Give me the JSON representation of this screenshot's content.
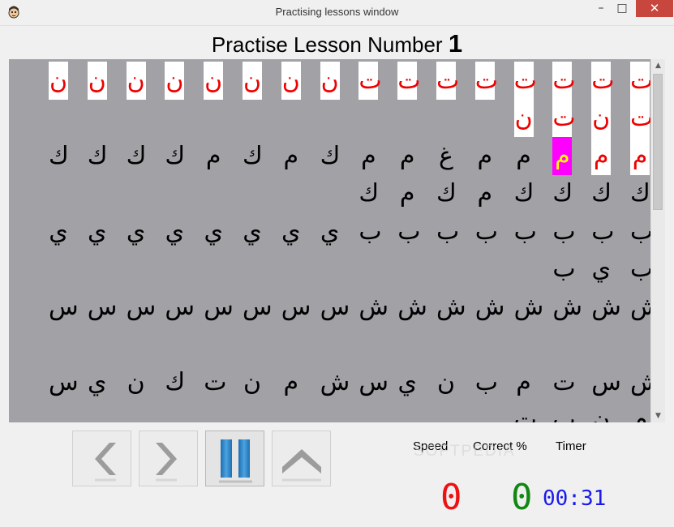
{
  "window": {
    "title": "Practising lessons window",
    "minimize_glyph": "–",
    "maximize_glyph": "□",
    "close_glyph": "✕"
  },
  "header": {
    "prefix": "Practise Lesson Number",
    "number": "1"
  },
  "practice_lines": [
    {
      "chars": [
        "ت",
        "ت",
        "ت",
        "ت",
        "ت",
        "ت",
        "ت",
        "ت",
        "ن",
        "ن",
        "ن",
        "ن",
        "ن",
        "ن",
        "ن",
        "ن",
        "ت",
        "ن",
        "ت",
        "ن"
      ],
      "typed": 20,
      "current": -1
    },
    {
      "chars": [
        "م",
        "م",
        "م",
        "م",
        "م",
        "غ",
        "م",
        "م",
        "ك",
        "م",
        "ك",
        "م",
        "ك",
        "ك",
        "ك",
        "ك",
        "ك",
        "ك",
        "ك",
        "ك",
        "م",
        "ك",
        "م",
        "ك"
      ],
      "typed": 2,
      "current": 2
    },
    {
      "chars": [
        "ب",
        "ب",
        "ب",
        "ب",
        "ب",
        "ب",
        "ب",
        "ب",
        "ي",
        "ي",
        "ي",
        "ي",
        "ي",
        "ي",
        "ي",
        "ي",
        "ب",
        "ي",
        "ب"
      ],
      "typed": 0,
      "current": -1
    },
    {
      "chars": [
        "ش",
        "ش",
        "ش",
        "ش",
        "ش",
        "ش",
        "ش",
        "ش",
        "س",
        "س",
        "س",
        "س",
        "س",
        "س",
        "س",
        "س"
      ],
      "typed": 0,
      "current": -1
    },
    {
      "chars": [
        "ش",
        "س",
        "ت",
        "م",
        "ب",
        "ن",
        "ي",
        "س",
        "ش",
        "م",
        "ن",
        "ت",
        "ك",
        "ن",
        "ي",
        "س",
        "م",
        "ن",
        "ب",
        "ت"
      ],
      "typed": 0,
      "current": -1
    }
  ],
  "scrollbar": {
    "up_glyph": "▲",
    "down_glyph": "▼"
  },
  "controls": {
    "back_icon": "chevron-left",
    "forward_icon": "chevron-right",
    "pause_icon": "pause",
    "up_icon": "chevron-up"
  },
  "stats": {
    "speed_label": "Speed",
    "correct_label": "Correct %",
    "timer_label": "Timer",
    "speed_value": "0",
    "correct_value": "0",
    "timer_value": "00:31",
    "speed_color": "#ee1111",
    "correct_color": "#118811",
    "timer_color": "#1a1aee"
  },
  "watermark": "SOFTPEDIA",
  "colors": {
    "practice_bg": "#a2a1a6",
    "typed_bg": "#ffffff",
    "typed_fg": "#ee0000",
    "current_bg": "#ff00ff",
    "current_fg": "#ffff00"
  }
}
